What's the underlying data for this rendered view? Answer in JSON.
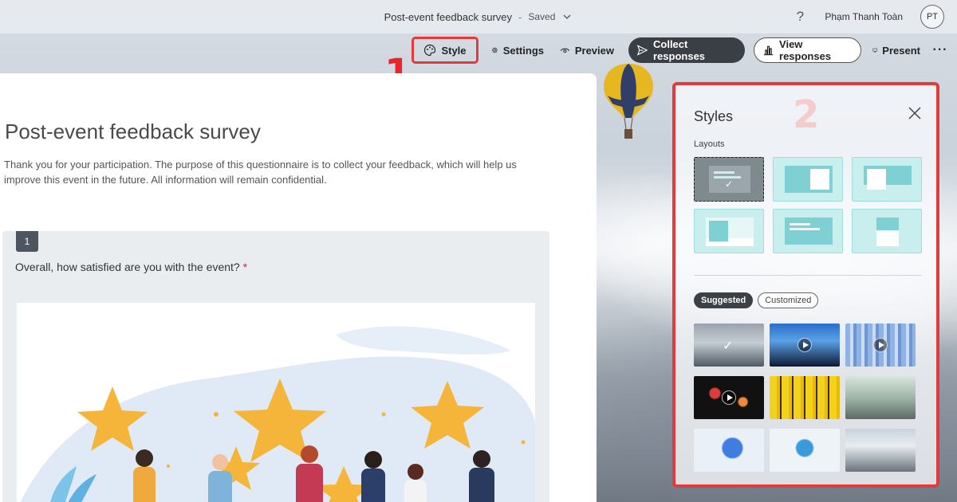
{
  "topbar": {
    "doc_title": "Post-event feedback survey",
    "separator": "-",
    "save_status": "Saved",
    "help_label": "?",
    "user_name": "Phạm Thanh Toàn",
    "user_initials": "PT"
  },
  "toolbar": {
    "style_label": "Style",
    "settings_label": "Settings",
    "preview_label": "Preview",
    "collect_label": "Collect responses",
    "view_label": "View responses",
    "present_label": "Present",
    "more_label": "···"
  },
  "annotations": {
    "marker_1": "1",
    "marker_2": "2"
  },
  "form": {
    "title": "Post-event feedback survey",
    "description": "Thank you for your participation. The purpose of this questionnaire is to collect your feedback, which will help us improve this event in the future. All information will remain confidential.",
    "question": {
      "number": "1",
      "text": "Overall, how satisfied are you with the event?",
      "required_mark": "*"
    }
  },
  "styles_panel": {
    "title": "Styles",
    "layouts_label": "Layouts",
    "layouts": [
      {
        "name": "layout-classic",
        "selected": true
      },
      {
        "name": "layout-image-right",
        "selected": false
      },
      {
        "name": "layout-image-left",
        "selected": false
      },
      {
        "name": "layout-banner-left",
        "selected": false
      },
      {
        "name": "layout-centered",
        "selected": false
      },
      {
        "name": "layout-image-top",
        "selected": false
      }
    ],
    "tabs": {
      "suggested": "Suggested",
      "customized": "Customized",
      "active": "suggested"
    },
    "themes": [
      {
        "name": "mountain-balloon",
        "video": false,
        "selected": true
      },
      {
        "name": "concert-crowd",
        "video": true,
        "selected": false
      },
      {
        "name": "city-skyline",
        "video": true,
        "selected": false
      },
      {
        "name": "fireworks",
        "video": true,
        "selected": false
      },
      {
        "name": "celebration-hands",
        "video": false,
        "selected": false
      },
      {
        "name": "conference-room",
        "video": false,
        "selected": false
      },
      {
        "name": "rating-illustration",
        "video": false,
        "selected": false
      },
      {
        "name": "feedback-illustration",
        "video": false,
        "selected": false
      },
      {
        "name": "mountain-balloon-2",
        "video": false,
        "selected": false
      }
    ]
  },
  "colors": {
    "accent_dark": "#3a3f45",
    "highlight_red": "#e23b3b",
    "layout_teal": "#c8eeee",
    "star_orange": "#f5b53a"
  }
}
